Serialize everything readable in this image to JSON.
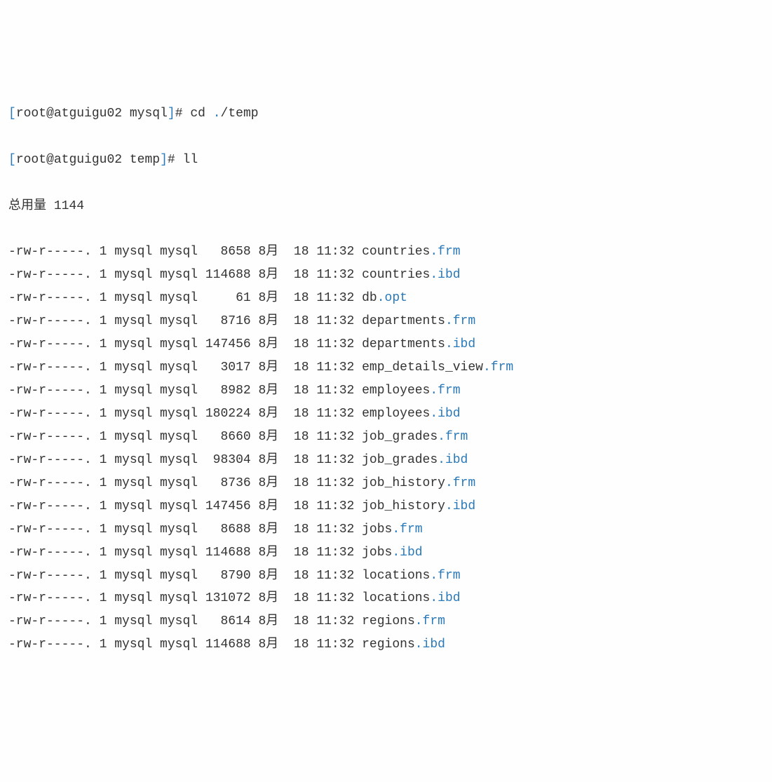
{
  "prompt1": {
    "open": "[",
    "user": "root",
    "at": "@",
    "host": "atguigu02",
    "dir": "mysql",
    "close": "]",
    "hash": "#",
    "cmd": "cd ",
    "dot": ".",
    "path": "/temp"
  },
  "prompt2": {
    "open": "[",
    "user": "root",
    "at": "@",
    "host": "atguigu02",
    "dir": "temp",
    "close": "]",
    "hash": "#",
    "cmd": "ll"
  },
  "total": {
    "label": "总用量 ",
    "value": "1144"
  },
  "files": [
    {
      "perm": "-rw-r-----.",
      "links": "1",
      "owner": "mysql",
      "group": "mysql",
      "size": "8658",
      "month": "8月",
      "day": "18",
      "time": "11:32",
      "name": "countries",
      "ext": ".frm"
    },
    {
      "perm": "-rw-r-----.",
      "links": "1",
      "owner": "mysql",
      "group": "mysql",
      "size": "114688",
      "month": "8月",
      "day": "18",
      "time": "11:32",
      "name": "countries",
      "ext": ".ibd"
    },
    {
      "perm": "-rw-r-----.",
      "links": "1",
      "owner": "mysql",
      "group": "mysql",
      "size": "61",
      "month": "8月",
      "day": "18",
      "time": "11:32",
      "name": "db",
      "ext": ".opt"
    },
    {
      "perm": "-rw-r-----.",
      "links": "1",
      "owner": "mysql",
      "group": "mysql",
      "size": "8716",
      "month": "8月",
      "day": "18",
      "time": "11:32",
      "name": "departments",
      "ext": ".frm"
    },
    {
      "perm": "-rw-r-----.",
      "links": "1",
      "owner": "mysql",
      "group": "mysql",
      "size": "147456",
      "month": "8月",
      "day": "18",
      "time": "11:32",
      "name": "departments",
      "ext": ".ibd"
    },
    {
      "perm": "-rw-r-----.",
      "links": "1",
      "owner": "mysql",
      "group": "mysql",
      "size": "3017",
      "month": "8月",
      "day": "18",
      "time": "11:32",
      "name": "emp_details_view",
      "ext": ".frm"
    },
    {
      "perm": "-rw-r-----.",
      "links": "1",
      "owner": "mysql",
      "group": "mysql",
      "size": "8982",
      "month": "8月",
      "day": "18",
      "time": "11:32",
      "name": "employees",
      "ext": ".frm"
    },
    {
      "perm": "-rw-r-----.",
      "links": "1",
      "owner": "mysql",
      "group": "mysql",
      "size": "180224",
      "month": "8月",
      "day": "18",
      "time": "11:32",
      "name": "employees",
      "ext": ".ibd"
    },
    {
      "perm": "-rw-r-----.",
      "links": "1",
      "owner": "mysql",
      "group": "mysql",
      "size": "8660",
      "month": "8月",
      "day": "18",
      "time": "11:32",
      "name": "job_grades",
      "ext": ".frm"
    },
    {
      "perm": "-rw-r-----.",
      "links": "1",
      "owner": "mysql",
      "group": "mysql",
      "size": "98304",
      "month": "8月",
      "day": "18",
      "time": "11:32",
      "name": "job_grades",
      "ext": ".ibd"
    },
    {
      "perm": "-rw-r-----.",
      "links": "1",
      "owner": "mysql",
      "group": "mysql",
      "size": "8736",
      "month": "8月",
      "day": "18",
      "time": "11:32",
      "name": "job_history",
      "ext": ".frm"
    },
    {
      "perm": "-rw-r-----.",
      "links": "1",
      "owner": "mysql",
      "group": "mysql",
      "size": "147456",
      "month": "8月",
      "day": "18",
      "time": "11:32",
      "name": "job_history",
      "ext": ".ibd"
    },
    {
      "perm": "-rw-r-----.",
      "links": "1",
      "owner": "mysql",
      "group": "mysql",
      "size": "8688",
      "month": "8月",
      "day": "18",
      "time": "11:32",
      "name": "jobs",
      "ext": ".frm"
    },
    {
      "perm": "-rw-r-----.",
      "links": "1",
      "owner": "mysql",
      "group": "mysql",
      "size": "114688",
      "month": "8月",
      "day": "18",
      "time": "11:32",
      "name": "jobs",
      "ext": ".ibd"
    },
    {
      "perm": "-rw-r-----.",
      "links": "1",
      "owner": "mysql",
      "group": "mysql",
      "size": "8790",
      "month": "8月",
      "day": "18",
      "time": "11:32",
      "name": "locations",
      "ext": ".frm"
    },
    {
      "perm": "-rw-r-----.",
      "links": "1",
      "owner": "mysql",
      "group": "mysql",
      "size": "131072",
      "month": "8月",
      "day": "18",
      "time": "11:32",
      "name": "locations",
      "ext": ".ibd"
    },
    {
      "perm": "-rw-r-----.",
      "links": "1",
      "owner": "mysql",
      "group": "mysql",
      "size": "8614",
      "month": "8月",
      "day": "18",
      "time": "11:32",
      "name": "regions",
      "ext": ".frm"
    },
    {
      "perm": "-rw-r-----.",
      "links": "1",
      "owner": "mysql",
      "group": "mysql",
      "size": "114688",
      "month": "8月",
      "day": "18",
      "time": "11:32",
      "name": "regions",
      "ext": ".ibd"
    }
  ]
}
